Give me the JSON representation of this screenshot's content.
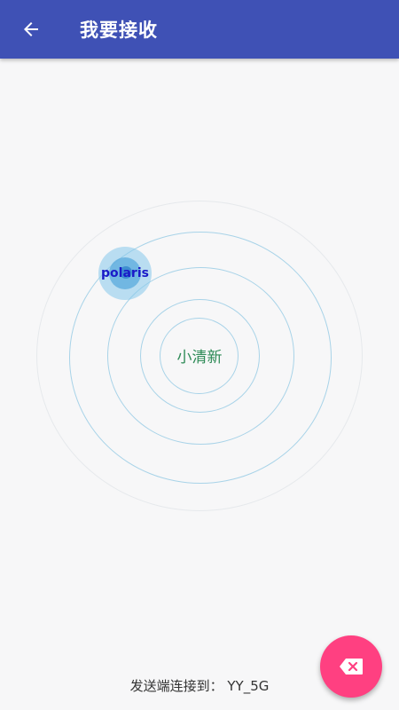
{
  "appbar": {
    "title": "我要接收",
    "back_icon": "arrow-back-icon",
    "color": "#3f51b5"
  },
  "radar": {
    "center_label": "小清新",
    "devices": [
      {
        "name": "polaris"
      }
    ],
    "ring_color": "#9fd0e6"
  },
  "status": {
    "text": "发送端连接到：  YY_5G"
  },
  "fab": {
    "icon": "backspace-icon",
    "color": "#ff4081"
  }
}
